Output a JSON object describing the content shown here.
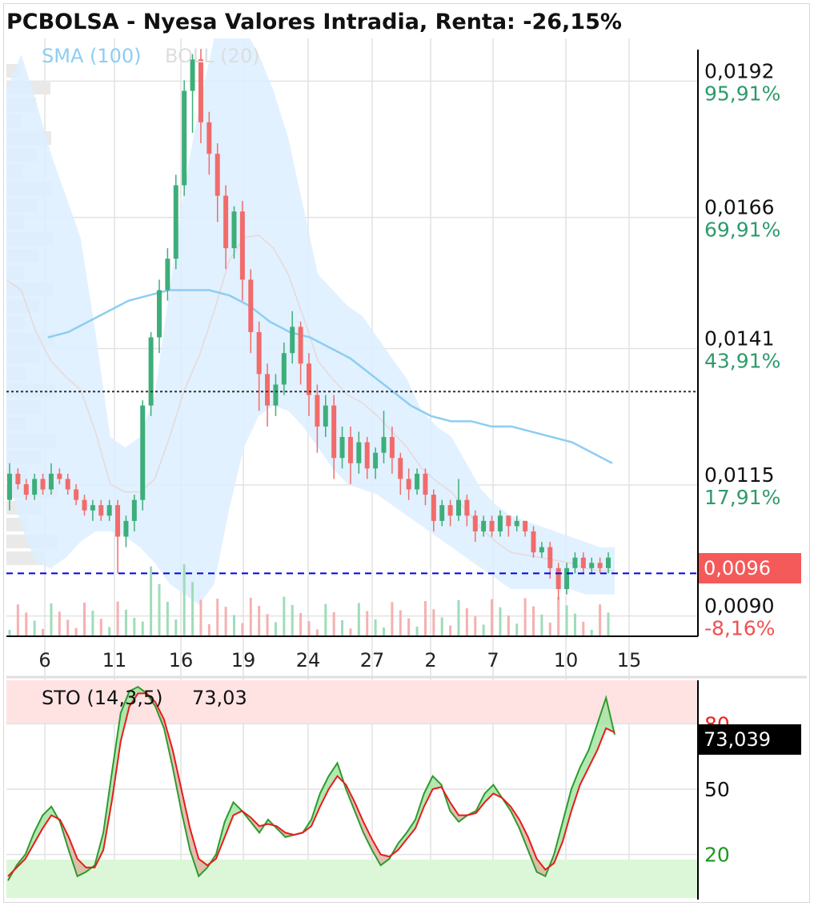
{
  "title": "PCBOLSA - Nyesa Valores Intradia, Renta: -26,15%",
  "indicators": {
    "sma_label": "SMA (100)",
    "boll_label": "BOLL (20)",
    "sto_label": "STO (14,3,5)",
    "sto_value": "73,03"
  },
  "tags": {
    "last_price": "0,0096",
    "sto_last": "73,039"
  },
  "colors": {
    "up": "#3dae7a",
    "down": "#f26b6b",
    "sma": "#8ecdf2",
    "band_fill": "#dcefff",
    "last_price_line": "#0000ee",
    "reference_line": "#333333",
    "sto_fast": "#2f9a2f",
    "sto_slow": "#e81b1b"
  },
  "chart_data": [
    {
      "type": "candlestick",
      "title": "PCBOLSA - Nyesa Valores Intradia, Renta: -26,15%",
      "x_ticks": [
        "6",
        "11",
        "16",
        "19",
        "24",
        "27",
        "2",
        "7",
        "10",
        "15"
      ],
      "y_ticks": [
        {
          "price": "0,0192",
          "change": "95,91%"
        },
        {
          "price": "0,0166",
          "change": "69,91%"
        },
        {
          "price": "0,0141",
          "change": "43,91%"
        },
        {
          "price": "0,0115",
          "change": "17,91%"
        },
        {
          "price": "0,0090",
          "change": "-8,16%"
        }
      ],
      "y_range": [
        0.0084,
        0.0198
      ],
      "reference_price": 0.0098,
      "last_price": 0.0096,
      "candles": [
        [
          0.011,
          0.0115,
          0.0108,
          0.0117
        ],
        [
          0.0115,
          0.0113,
          0.0112,
          0.0116
        ],
        [
          0.0113,
          0.0111,
          0.011,
          0.0114
        ],
        [
          0.0111,
          0.0114,
          0.011,
          0.0115
        ],
        [
          0.0114,
          0.0112,
          0.0111,
          0.0115
        ],
        [
          0.0112,
          0.0115,
          0.0111,
          0.0117
        ],
        [
          0.0115,
          0.0114,
          0.0113,
          0.0116
        ],
        [
          0.0114,
          0.0112,
          0.0111,
          0.0115
        ],
        [
          0.0112,
          0.011,
          0.0109,
          0.0113
        ],
        [
          0.011,
          0.0108,
          0.0107,
          0.0111
        ],
        [
          0.0108,
          0.0109,
          0.0106,
          0.011
        ],
        [
          0.0109,
          0.0107,
          0.0106,
          0.011
        ],
        [
          0.0107,
          0.0109,
          0.0106,
          0.011
        ],
        [
          0.0109,
          0.0103,
          0.0096,
          0.011
        ],
        [
          0.0103,
          0.0106,
          0.0101,
          0.0107
        ],
        [
          0.0106,
          0.011,
          0.0104,
          0.0111
        ],
        [
          0.011,
          0.0128,
          0.0108,
          0.0129
        ],
        [
          0.0128,
          0.0141,
          0.0126,
          0.0142
        ],
        [
          0.0141,
          0.015,
          0.0138,
          0.0152
        ],
        [
          0.015,
          0.0156,
          0.0148,
          0.0158
        ],
        [
          0.0156,
          0.017,
          0.0154,
          0.0172
        ],
        [
          0.017,
          0.0188,
          0.0168,
          0.019
        ],
        [
          0.0188,
          0.0194,
          0.018,
          0.0195
        ],
        [
          0.0194,
          0.0182,
          0.0178,
          0.0196
        ],
        [
          0.0182,
          0.0176,
          0.0172,
          0.0184
        ],
        [
          0.0176,
          0.0168,
          0.0163,
          0.0178
        ],
        [
          0.0168,
          0.0158,
          0.0154,
          0.017
        ],
        [
          0.0158,
          0.0165,
          0.0156,
          0.0166
        ],
        [
          0.0165,
          0.0152,
          0.0148,
          0.0167
        ],
        [
          0.0152,
          0.0142,
          0.0138,
          0.0154
        ],
        [
          0.0142,
          0.0134,
          0.0127,
          0.0144
        ],
        [
          0.0134,
          0.0128,
          0.0124,
          0.0136
        ],
        [
          0.0128,
          0.0132,
          0.0126,
          0.0134
        ],
        [
          0.0132,
          0.0138,
          0.013,
          0.014
        ],
        [
          0.0138,
          0.0143,
          0.0136,
          0.0146
        ],
        [
          0.0143,
          0.0136,
          0.0132,
          0.0144
        ],
        [
          0.0136,
          0.013,
          0.0126,
          0.0138
        ],
        [
          0.013,
          0.0124,
          0.0119,
          0.0132
        ],
        [
          0.0124,
          0.0128,
          0.0122,
          0.013
        ],
        [
          0.0128,
          0.0118,
          0.0114,
          0.013
        ],
        [
          0.0118,
          0.0122,
          0.0116,
          0.0124
        ],
        [
          0.0122,
          0.0117,
          0.0113,
          0.0124
        ],
        [
          0.0117,
          0.0121,
          0.0115,
          0.0123
        ],
        [
          0.0121,
          0.0116,
          0.0114,
          0.0122
        ],
        [
          0.0116,
          0.0119,
          0.0114,
          0.012
        ],
        [
          0.0119,
          0.0122,
          0.0117,
          0.0127
        ],
        [
          0.0122,
          0.0118,
          0.0115,
          0.0124
        ],
        [
          0.0118,
          0.0114,
          0.0111,
          0.0119
        ],
        [
          0.0114,
          0.0112,
          0.011,
          0.0116
        ],
        [
          0.0112,
          0.0115,
          0.0111,
          0.0116
        ],
        [
          0.0115,
          0.0111,
          0.0109,
          0.0116
        ],
        [
          0.0111,
          0.0106,
          0.0104,
          0.0112
        ],
        [
          0.0106,
          0.0109,
          0.0105,
          0.011
        ],
        [
          0.0109,
          0.0107,
          0.0105,
          0.011
        ],
        [
          0.0107,
          0.011,
          0.0106,
          0.0114
        ],
        [
          0.011,
          0.0107,
          0.0105,
          0.0111
        ],
        [
          0.0107,
          0.0104,
          0.0102,
          0.0108
        ],
        [
          0.0104,
          0.0106,
          0.0103,
          0.0107
        ],
        [
          0.0106,
          0.0104,
          0.0103,
          0.0107
        ],
        [
          0.0104,
          0.0107,
          0.0103,
          0.0108
        ],
        [
          0.0107,
          0.0105,
          0.0103,
          0.0107
        ],
        [
          0.0105,
          0.0106,
          0.0104,
          0.0107
        ],
        [
          0.0106,
          0.0104,
          0.0103,
          0.0106
        ],
        [
          0.0104,
          0.01,
          0.0099,
          0.0105
        ],
        [
          0.01,
          0.0101,
          0.0099,
          0.0102
        ],
        [
          0.0101,
          0.0097,
          0.0095,
          0.0102
        ],
        [
          0.0097,
          0.0093,
          0.0091,
          0.0098
        ],
        [
          0.0093,
          0.0097,
          0.0092,
          0.0098
        ],
        [
          0.0097,
          0.0099,
          0.0096,
          0.01
        ],
        [
          0.0099,
          0.0097,
          0.0096,
          0.01
        ],
        [
          0.0097,
          0.0098,
          0.0096,
          0.0099
        ],
        [
          0.0098,
          0.0097,
          0.0096,
          0.0099
        ],
        [
          0.0097,
          0.0099,
          0.0096,
          0.01
        ]
      ],
      "sma_100": [
        [
          0.0141,
          0.0142,
          0.0144,
          0.0146,
          0.0148,
          0.0149,
          0.015,
          0.015,
          0.015,
          0.0149,
          0.0147,
          0.0144,
          0.0142,
          0.0141,
          0.0139,
          0.0137,
          0.0134,
          0.0131,
          0.0128,
          0.0126,
          0.0125,
          0.0125,
          0.0124,
          0.0124,
          0.0123,
          0.0122,
          0.0121,
          0.0119,
          0.0117
        ]
      ],
      "bollinger": {
        "upper": [
          0.0188,
          0.0195,
          0.0186,
          0.0176,
          0.0168,
          0.016,
          0.0142,
          0.0122,
          0.012,
          0.0122,
          0.013,
          0.015,
          0.017,
          0.0185,
          0.0198,
          0.0203,
          0.02,
          0.0195,
          0.0188,
          0.0179,
          0.0166,
          0.0153,
          0.015,
          0.0147,
          0.0145,
          0.0141,
          0.0137,
          0.0133,
          0.0127,
          0.0124,
          0.0122,
          0.0117,
          0.0112,
          0.0109,
          0.0107,
          0.0106,
          0.0105,
          0.0104,
          0.0103,
          0.0102,
          0.0101,
          0.0101
        ],
        "lower": [
          0.0116,
          0.0105,
          0.0098,
          0.0097,
          0.0099,
          0.0102,
          0.0104,
          0.0104,
          0.0103,
          0.0101,
          0.0098,
          0.0094,
          0.0092,
          0.009,
          0.0094,
          0.0108,
          0.012,
          0.0126,
          0.0128,
          0.0127,
          0.0124,
          0.012,
          0.0116,
          0.0113,
          0.0112,
          0.0111,
          0.0109,
          0.0107,
          0.0105,
          0.0103,
          0.0101,
          0.0099,
          0.0097,
          0.0095,
          0.0093,
          0.0093,
          0.0093,
          0.0093,
          0.0093,
          0.0092,
          0.0092,
          0.0092
        ]
      },
      "volume_scale": 100
    },
    {
      "type": "line",
      "title": "STO (14,3,5)",
      "y_ticks": [
        "80",
        "50",
        "20"
      ],
      "y_range": [
        0,
        100
      ],
      "overbought": 80,
      "oversold": 20,
      "series": [
        {
          "name": "%K",
          "values": [
            8,
            15,
            20,
            30,
            38,
            42,
            35,
            22,
            10,
            12,
            15,
            30,
            58,
            85,
            95,
            97,
            94,
            88,
            78,
            60,
            40,
            22,
            10,
            14,
            20,
            35,
            44,
            40,
            35,
            30,
            36,
            32,
            28,
            29,
            30,
            36,
            48,
            56,
            62,
            50,
            40,
            30,
            22,
            15,
            18,
            25,
            30,
            36,
            48,
            56,
            52,
            40,
            35,
            38,
            40,
            48,
            52,
            46,
            40,
            32,
            22,
            12,
            10,
            20,
            35,
            50,
            60,
            68,
            80,
            92,
            75
          ]
        },
        {
          "name": "%D",
          "values": [
            10,
            14,
            18,
            25,
            32,
            38,
            36,
            28,
            18,
            14,
            14,
            22,
            45,
            72,
            88,
            94,
            94,
            90,
            82,
            68,
            50,
            32,
            18,
            15,
            18,
            28,
            38,
            40,
            37,
            33,
            34,
            33,
            30,
            29,
            30,
            33,
            42,
            50,
            56,
            52,
            44,
            35,
            27,
            20,
            19,
            22,
            27,
            32,
            42,
            50,
            51,
            44,
            38,
            38,
            39,
            44,
            48,
            46,
            42,
            36,
            28,
            18,
            13,
            16,
            26,
            40,
            52,
            60,
            68,
            78,
            76
          ]
        }
      ],
      "last_value": 73.039
    }
  ]
}
